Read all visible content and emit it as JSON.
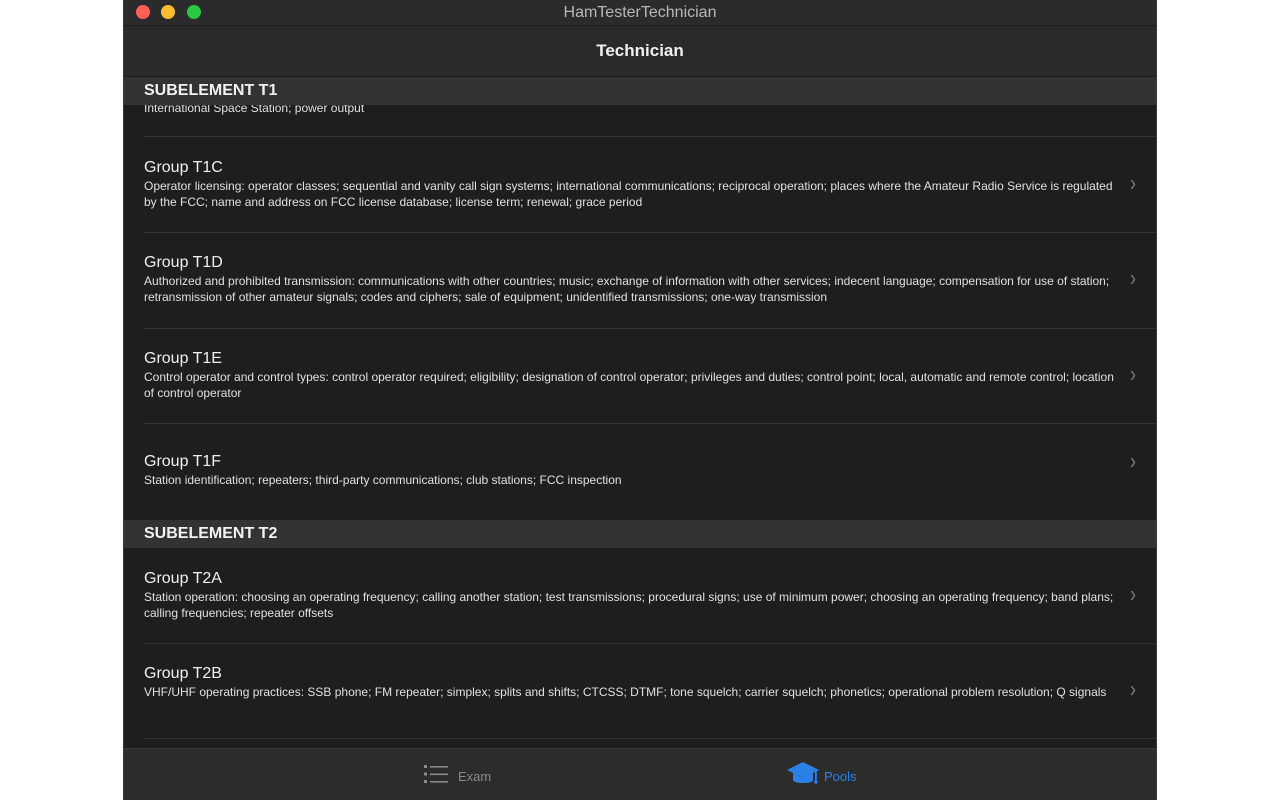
{
  "window": {
    "title": "HamTesterTechnician"
  },
  "navbar": {
    "title": "Technician"
  },
  "sections": [
    {
      "header": "SUBELEMENT T1",
      "partial_row_desc": "International Space Station; power output",
      "rows": [
        {
          "title": "Group T1C",
          "desc": "Operator licensing: operator classes; sequential and vanity call sign systems; international communications; reciprocal operation; places where the Amateur Radio Service is regulated by the FCC; name and address on FCC license database; license term; renewal; grace period"
        },
        {
          "title": "Group T1D",
          "desc": "Authorized and prohibited transmission: communications with other countries; music; exchange of information with other services; indecent language; compensation for use of station; retransmission of other amateur signals; codes and ciphers; sale of equipment; unidentified transmissions; one-way transmission"
        },
        {
          "title": "Group T1E",
          "desc": "Control operator and control types: control operator required; eligibility; designation of control operator; privileges and duties; control point; local, automatic and remote control; location of control operator"
        },
        {
          "title": "Group T1F",
          "desc": "Station identification; repeaters; third-party communications; club stations; FCC inspection"
        }
      ]
    },
    {
      "header": "SUBELEMENT T2",
      "rows": [
        {
          "title": "Group T2A",
          "desc": "Station operation: choosing an operating frequency; calling another station; test transmissions; procedural signs; use of minimum power; choosing an operating frequency; band plans; calling frequencies; repeater offsets"
        },
        {
          "title": "Group T2B",
          "desc": "VHF/UHF operating practices: SSB phone; FM repeater; simplex; splits and shifts; CTCSS; DTMF; tone squelch; carrier squelch; phonetics; operational problem resolution; Q signals"
        }
      ]
    }
  ],
  "tabbar": {
    "exam_label": "Exam",
    "pools_label": "Pools",
    "active_tab": "Pools",
    "active_color": "#2a82e8",
    "inactive_color": "#8a8a8a",
    "exam_icon": "list-icon",
    "pools_icon": "graduation-cap-icon"
  },
  "chevron_glyph": "›"
}
